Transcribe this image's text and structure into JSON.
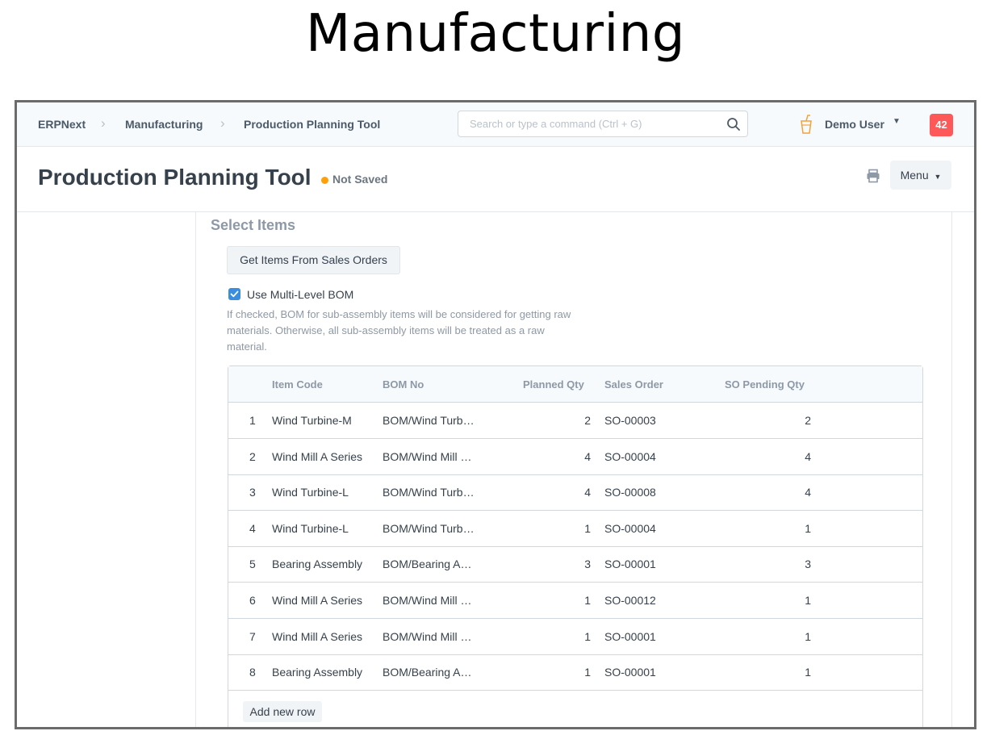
{
  "slide": {
    "title": "Manufacturing"
  },
  "navbar": {
    "breadcrumbs": [
      "ERPNext",
      "Manufacturing",
      "Production Planning Tool"
    ],
    "search_placeholder": "Search or type a command (Ctrl + G)",
    "user_name": "Demo User",
    "notification_count": "42",
    "icons": {
      "search": "search-icon",
      "user": "drink-cup-icon",
      "caret": "caret-down-icon"
    }
  },
  "page_head": {
    "title": "Production Planning Tool",
    "status": "Not Saved",
    "status_color": "#ffa00a",
    "menu_label": "Menu",
    "icons": {
      "print": "print-icon"
    }
  },
  "form": {
    "section_title": "Select Items",
    "get_items_label": "Get Items From Sales Orders",
    "use_multi_level_bom": {
      "label": "Use Multi-Level BOM",
      "checked": true
    },
    "help_text": "If checked, BOM for sub-assembly items will be considered for getting raw materials. Otherwise, all sub-assembly items will be treated as a raw material."
  },
  "grid": {
    "columns": [
      "Item Code",
      "BOM No",
      "Planned Qty",
      "Sales Order",
      "SO Pending Qty"
    ],
    "rows": [
      {
        "idx": "1",
        "item_code": "Wind Turbine-M",
        "bom_no": "BOM/Wind Turb…",
        "planned_qty": "2",
        "sales_order": "SO-00003",
        "pending_qty": "2"
      },
      {
        "idx": "2",
        "item_code": "Wind Mill A Series",
        "bom_no": "BOM/Wind Mill …",
        "planned_qty": "4",
        "sales_order": "SO-00004",
        "pending_qty": "4"
      },
      {
        "idx": "3",
        "item_code": "Wind Turbine-L",
        "bom_no": "BOM/Wind Turb…",
        "planned_qty": "4",
        "sales_order": "SO-00008",
        "pending_qty": "4"
      },
      {
        "idx": "4",
        "item_code": "Wind Turbine-L",
        "bom_no": "BOM/Wind Turb…",
        "planned_qty": "1",
        "sales_order": "SO-00004",
        "pending_qty": "1"
      },
      {
        "idx": "5",
        "item_code": "Bearing Assembly",
        "bom_no": "BOM/Bearing A…",
        "planned_qty": "3",
        "sales_order": "SO-00001",
        "pending_qty": "3"
      },
      {
        "idx": "6",
        "item_code": "Wind Mill A Series",
        "bom_no": "BOM/Wind Mill …",
        "planned_qty": "1",
        "sales_order": "SO-00012",
        "pending_qty": "1"
      },
      {
        "idx": "7",
        "item_code": "Wind Mill A Series",
        "bom_no": "BOM/Wind Mill …",
        "planned_qty": "1",
        "sales_order": "SO-00001",
        "pending_qty": "1"
      },
      {
        "idx": "8",
        "item_code": "Bearing Assembly",
        "bom_no": "BOM/Bearing A…",
        "planned_qty": "1",
        "sales_order": "SO-00001",
        "pending_qty": "1"
      }
    ],
    "add_row_label": "Add new row"
  }
}
